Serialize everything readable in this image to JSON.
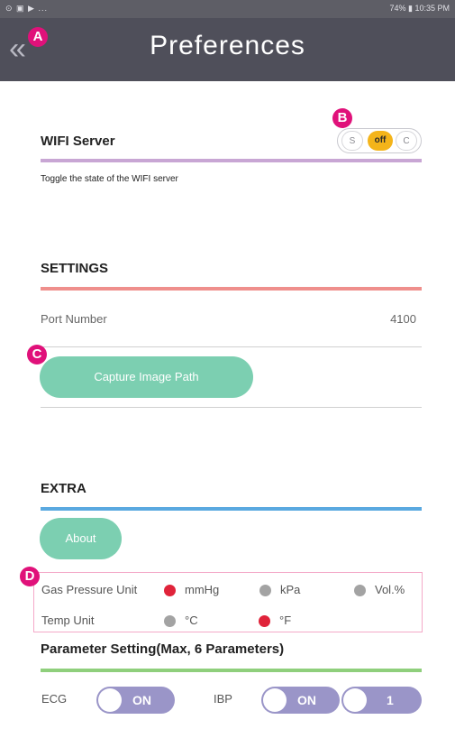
{
  "status_bar": {
    "left_icons": "⊙ ▣ ▶ ...",
    "right_text": "74% ▮ 10:35 PM"
  },
  "header": {
    "back_icon": "chevrons-left-icon",
    "title": "Preferences"
  },
  "markers": {
    "a": "A",
    "b": "B",
    "c": "C",
    "d": "D"
  },
  "wifi": {
    "title": "WIFI Server",
    "description": "Toggle the state of the WIFI server",
    "options": [
      "S",
      "off",
      "C"
    ],
    "selected": "off"
  },
  "settings": {
    "title": "SETTINGS",
    "port_label": "Port Number",
    "port_value": "4100",
    "capture_button": "Capture Image Path"
  },
  "extra": {
    "title": "EXTRA",
    "about_button": "About",
    "gas_label": "Gas Pressure Unit",
    "gas_options": [
      "mmHg",
      "kPa",
      "Vol.%"
    ],
    "gas_selected": "mmHg",
    "temp_label": "Temp Unit",
    "temp_options": [
      "°C",
      "°F"
    ],
    "temp_selected": "°F"
  },
  "parameters": {
    "title": "Parameter Setting(Max, 6 Parameters)",
    "ecg_label": "ECG",
    "ecg_toggle": "ON",
    "ibp_label": "IBP",
    "ibp_toggle": "ON",
    "ibp_count": "1"
  },
  "colors": {
    "header_bg": "#4f4f5a",
    "wifi_bar": "#c8a6d4",
    "settings_bar": "#ef8f8c",
    "extra_bar": "#5aa9e0",
    "param_bar": "#8fcf7c",
    "accent_green": "#7ccfb1",
    "toggle_purple": "#9a95c8",
    "marker_pink": "#e0117a"
  }
}
